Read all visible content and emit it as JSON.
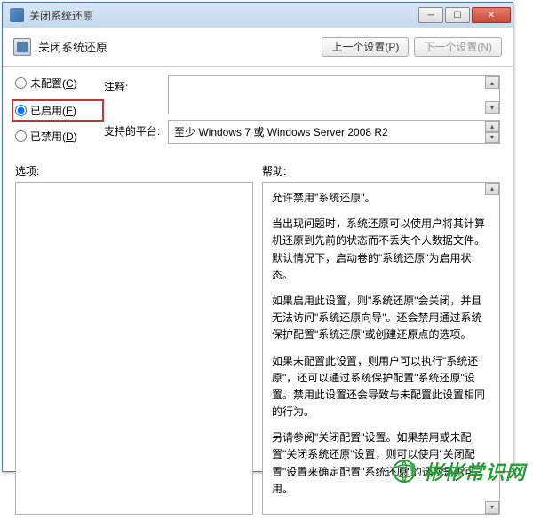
{
  "titlebar": {
    "title": "关闭系统还原"
  },
  "winbtns": {
    "min": "─",
    "max": "☐",
    "close": "✕"
  },
  "header": {
    "title": "关闭系统还原",
    "prev": "上一个设置(P)",
    "next": "下一个设置(N)"
  },
  "radios": {
    "unconfigured": "未配置(C)",
    "enabled": "已启用(E)",
    "disabled": "已禁用(D)"
  },
  "fields": {
    "comment_label": "注释:",
    "comment_value": "",
    "platform_label": "支持的平台:",
    "platform_value": "至少 Windows 7 或 Windows Server 2008 R2"
  },
  "lower": {
    "options_label": "选项:",
    "help_label": "帮助:",
    "help_text": {
      "p1": "允许禁用\"系统还原\"。",
      "p2": "当出现问题时，系统还原可以使用户将其计算机还原到先前的状态而不丢失个人数据文件。默认情况下，启动卷的\"系统还原\"为启用状态。",
      "p3": "如果启用此设置，则\"系统还原\"会关闭，并且无法访问\"系统还原向导\"。还会禁用通过系统保护配置\"系统还原\"或创建还原点的选项。",
      "p4": "如果未配置此设置，则用户可以执行\"系统还原\"，还可以通过系统保护配置\"系统还原\"设置。禁用此设置还会导致与未配置此设置相同的行为。",
      "p5": "另请参阅\"关闭配置\"设置。如果禁用或未配置\"关闭系统还原\"设置，则可以使用\"关闭配置\"设置来确定配置\"系统还原\"的选项是否可用。"
    }
  },
  "watermark": {
    "text": "彬彬常识网"
  }
}
